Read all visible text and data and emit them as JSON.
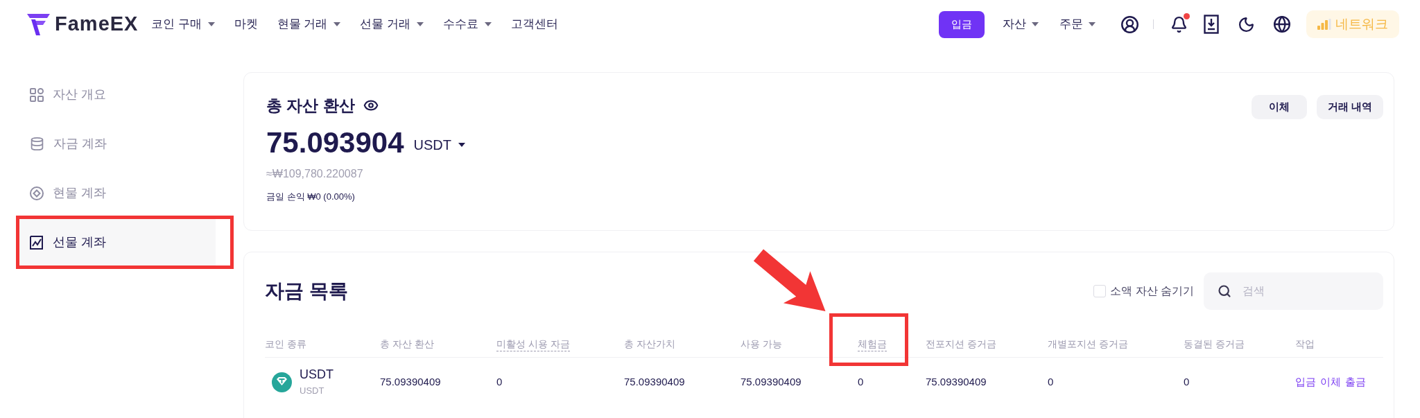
{
  "header": {
    "logo": "FameEX",
    "nav": [
      {
        "label": "코인 구매",
        "dropdown": true
      },
      {
        "label": "마켓",
        "dropdown": false
      },
      {
        "label": "현물 거래",
        "dropdown": true
      },
      {
        "label": "선물 거래",
        "dropdown": true
      },
      {
        "label": "수수료",
        "dropdown": true
      },
      {
        "label": "고객센터",
        "dropdown": false
      }
    ],
    "deposit": "입금",
    "menus": [
      {
        "label": "자산",
        "dropdown": true
      },
      {
        "label": "주문",
        "dropdown": true
      }
    ],
    "has_unread": true,
    "network": "네트워크"
  },
  "sidebar": {
    "items": [
      {
        "label": "자산 개요",
        "selected": false,
        "highlighted": false
      },
      {
        "label": "자금 계좌",
        "selected": false,
        "highlighted": false
      },
      {
        "label": "현물 계좌",
        "selected": false,
        "highlighted": false
      },
      {
        "label": "선물 계좌",
        "selected": true,
        "highlighted": true
      }
    ]
  },
  "summary": {
    "title": "총 자산 환산",
    "amount": "75.093904",
    "currency": "USDT",
    "approx": "≈₩109,780.220087",
    "pnl": "금일 손익 ₩0 (0.00%)",
    "buttons": [
      "이체",
      "거래 내역"
    ]
  },
  "funds": {
    "title": "자금 목록",
    "hide_small": {
      "label": "소액 자산 숨기기",
      "checked": false
    },
    "search": {
      "placeholder": "검색"
    },
    "columns": [
      {
        "label": "코인 종류",
        "has_tooltip": false,
        "highlighted": false
      },
      {
        "label": "총 자산 환산",
        "has_tooltip": false,
        "highlighted": false
      },
      {
        "label": "미활성 시용 자금",
        "has_tooltip": true,
        "highlighted": false
      },
      {
        "label": "총 자산가치",
        "has_tooltip": false,
        "highlighted": false
      },
      {
        "label": "사용 가능",
        "has_tooltip": false,
        "highlighted": false
      },
      {
        "label": "체험금",
        "has_tooltip": true,
        "highlighted": true
      },
      {
        "label": "전포지션 증거금",
        "has_tooltip": false,
        "highlighted": false
      },
      {
        "label": "개별포지션 증거금",
        "has_tooltip": false,
        "highlighted": false
      },
      {
        "label": "동결된 증거금",
        "has_tooltip": false,
        "highlighted": false
      },
      {
        "label": "작업",
        "has_tooltip": false,
        "highlighted": false
      }
    ],
    "rows": [
      {
        "cells": [
          {
            "kind": "coin",
            "name": "USDT",
            "sub": "USDT"
          },
          {
            "kind": "text",
            "value": "75.09390409"
          },
          {
            "kind": "text",
            "value": "0"
          },
          {
            "kind": "text",
            "value": "75.09390409"
          },
          {
            "kind": "text",
            "value": "75.09390409"
          },
          {
            "kind": "text",
            "value": "0"
          },
          {
            "kind": "text",
            "value": "75.09390409"
          },
          {
            "kind": "text",
            "value": "0"
          },
          {
            "kind": "text",
            "value": "0"
          },
          {
            "kind": "actions",
            "links": [
              "입금",
              "이체",
              "출금"
            ]
          }
        ]
      }
    ]
  }
}
